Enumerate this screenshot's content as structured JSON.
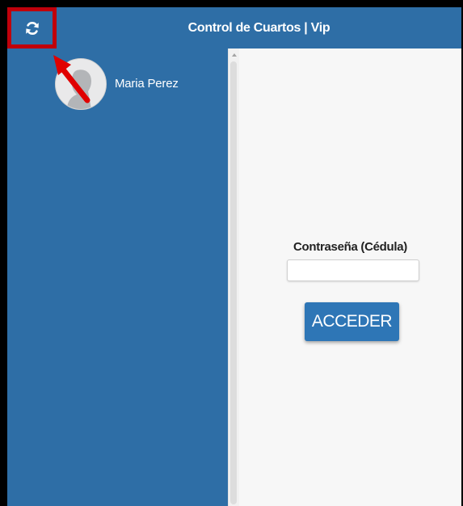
{
  "header": {
    "title": "Control de Cuartos | Vip",
    "refresh_icon": "refresh-icon",
    "color": "#2e6ea6"
  },
  "sidebar": {
    "user": {
      "name": "Maria Perez",
      "avatar_icon": "user-avatar-icon"
    },
    "color": "#2e6ea6"
  },
  "login": {
    "password_label": "Contraseña (Cédula)",
    "password_value": "",
    "password_placeholder": "",
    "submit_label": "ACCEDER",
    "button_color": "#2e76b6"
  },
  "annotation": {
    "highlight_color": "#c0000b",
    "arrow_color": "#e00000"
  }
}
